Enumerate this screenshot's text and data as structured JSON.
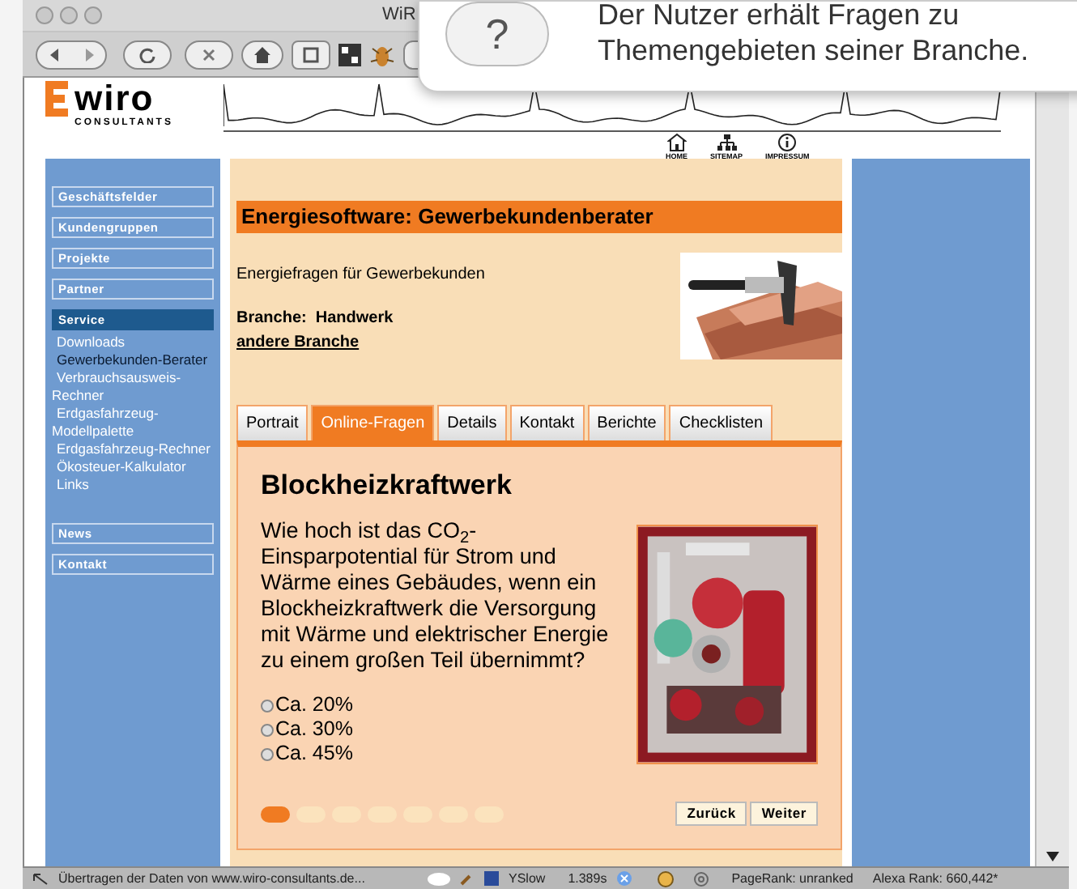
{
  "browser": {
    "title": "WiR",
    "status_text": "Übertragen der Daten von www.wiro-consultants.de...",
    "status_items": [
      "YSlow",
      "1.389s",
      "PageRank: unranked",
      "Alexa Rank: 660,442*"
    ]
  },
  "tooltip": {
    "icon_text": "?",
    "lines": [
      "Der Nutzer erhält Fragen zu",
      "Themengebieten seiner Branche."
    ]
  },
  "logo": {
    "name": "wiro",
    "tagline": "CONSULTANTS"
  },
  "top_links": [
    {
      "kind": "home",
      "label": "HOME"
    },
    {
      "kind": "sitemap",
      "label": "SITEMAP"
    },
    {
      "kind": "info",
      "label": "IMPRESSUM"
    }
  ],
  "nav": [
    {
      "kind": "section",
      "label": "Geschäftsfelder",
      "selected": false
    },
    {
      "kind": "section",
      "label": "Kundengruppen",
      "selected": false
    },
    {
      "kind": "section",
      "label": "Projekte",
      "selected": false
    },
    {
      "kind": "section",
      "label": "Partner",
      "selected": false
    },
    {
      "kind": "section",
      "label": "Service",
      "selected": true
    },
    {
      "kind": "link",
      "label": "Downloads",
      "selected": false
    },
    {
      "kind": "link",
      "label": "Gewerbekunden-Berater",
      "selected": true
    },
    {
      "kind": "link",
      "label": "Verbrauchsausweis-Rechner",
      "selected": false
    },
    {
      "kind": "link",
      "label": "Erdgasfahrzeug-Modellpalette",
      "selected": false
    },
    {
      "kind": "link",
      "label": "Erdgasfahrzeug-Rechner",
      "selected": false
    },
    {
      "kind": "link",
      "label": "Ökosteuer-Kalkulator",
      "selected": false
    },
    {
      "kind": "link",
      "label": "Links",
      "selected": false
    },
    {
      "kind": "gap"
    },
    {
      "kind": "section",
      "label": "News",
      "selected": false
    },
    {
      "kind": "section",
      "label": "Kontakt",
      "selected": false
    }
  ],
  "page": {
    "title": "Energiesoftware: Gewerbekundenberater",
    "intro": "Energiefragen für Gewerbekunden",
    "branche": "Branche:  Handwerk",
    "branche_link": "andere Branche"
  },
  "tabs": [
    {
      "label": "Portrait",
      "selected": false
    },
    {
      "label": "Online-Fragen",
      "selected": true
    },
    {
      "label": "Details",
      "selected": false
    },
    {
      "label": "Kontakt",
      "selected": false
    },
    {
      "label": "Berichte",
      "selected": false
    },
    {
      "label": "Checklisten",
      "selected": false
    }
  ],
  "question": {
    "heading": "Blockheizkraftwerk",
    "text": "Wie hoch ist das CO$_{2}$-Einsparpotential für Strom und Wärme eines Gebäudes, wenn ein Blockheizkraftwerk die Versorgung mit Wärme und elektrischer Energie zu einem großen Teil übernimmt?",
    "options": [
      {
        "label": "Ca. 20%",
        "checked": false
      },
      {
        "label": "Ca. 30%",
        "checked": false
      },
      {
        "label": "Ca. 45%",
        "checked": false
      }
    ],
    "steps": [
      {
        "selected": true
      },
      {
        "selected": false
      },
      {
        "selected": false
      },
      {
        "selected": false
      },
      {
        "selected": false
      },
      {
        "selected": false
      },
      {
        "selected": false
      }
    ],
    "buttons": [
      "Zurück",
      "Weiter"
    ]
  }
}
